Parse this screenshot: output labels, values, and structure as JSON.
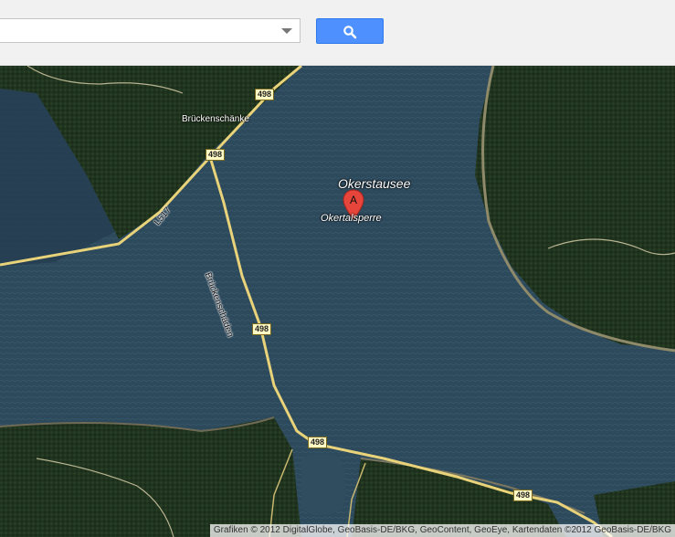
{
  "search": {
    "value": "",
    "placeholder": ""
  },
  "icons": {
    "search_button_icon": "search-icon",
    "dropdown_icon": "chevron-down-icon",
    "marker_icon": "map-pin-icon"
  },
  "map": {
    "lake_label": "Okerstausee",
    "marker_letter": "A",
    "marker_label": "Okertalsperre",
    "place_label": "Brückenschänke",
    "road_labels": {
      "brueckenschaeden": "Brückenschäden",
      "l517": "L517"
    },
    "road_shields": [
      "498",
      "498",
      "498",
      "498",
      "498"
    ],
    "copyright": "Grafiken © 2012 DigitalGlobe, GeoBasis-DE/BKG, GeoContent, GeoEye, Kartendaten ©2012 GeoBasis-DE/BKG"
  },
  "colors": {
    "search_button": "#4d90fe",
    "water": "#2b4658",
    "forest": "#22351f",
    "road": "#e8d37a",
    "marker": "#e5453b"
  }
}
